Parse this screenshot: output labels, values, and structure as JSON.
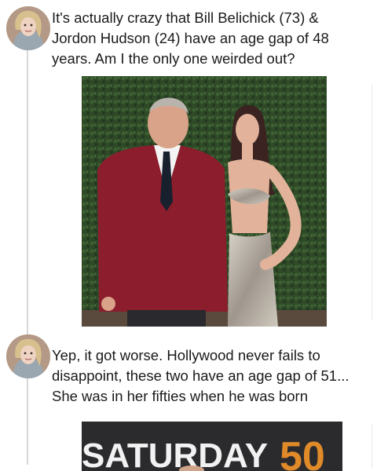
{
  "posts": [
    {
      "text": "It's actually crazy that Bill Belichick (73) & Jordon Hudson (24) have an age gap of 48 years. Am I the only one weirded out?",
      "media": "photo-couple"
    },
    {
      "text": "Yep, it got worse. Hollywood never fails to disappoint, these two have an age gap of 51... She was in her fifties when he was born",
      "media": "photo-event-backdrop",
      "media_text": "SATURDAY",
      "media_number": "50"
    }
  ],
  "colors": {
    "blazer": "#8b1d2c",
    "backdrop_green": "#2f4a28",
    "banner_dark": "#2b2b2e",
    "banner_gold": "#e08a2a"
  },
  "icons": [
    "avatar-user"
  ]
}
